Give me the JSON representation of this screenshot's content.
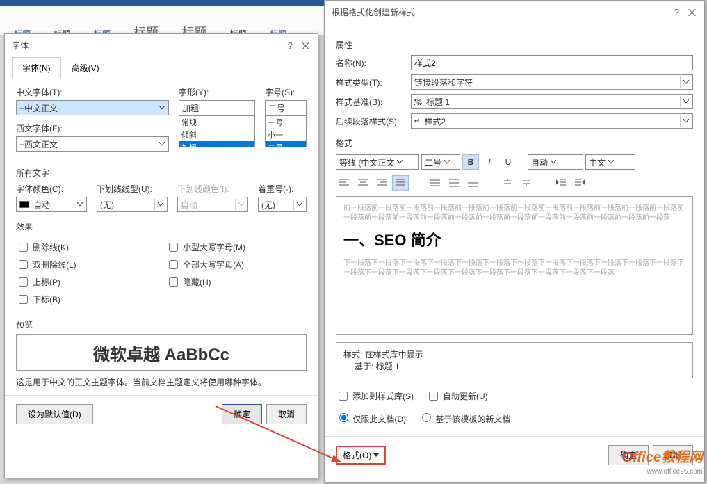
{
  "ribbon": {
    "tabs": [
      "标题",
      "标题",
      "标题",
      "标题",
      "标题",
      "标题",
      "标题"
    ]
  },
  "fontDialog": {
    "title": "字体",
    "tab1": "字体(N)",
    "tab2": "高级(V)",
    "cnFontLbl": "中文字体(T):",
    "cnFontVal": "+中文正文",
    "enFontLbl": "西文字体(F):",
    "enFontVal": "+西文正文",
    "styleLbl": "字形(Y):",
    "styleVal": "加粗",
    "styleOpts": [
      "常规",
      "倾斜",
      "加粗"
    ],
    "sizeLbl": "字号(S):",
    "sizeVal": "二号",
    "sizeOpts": [
      "一号",
      "小一",
      "二号"
    ],
    "allText": "所有文字",
    "colorLbl": "字体颜色(C):",
    "colorVal": "自动",
    "ulStyleLbl": "下划线线型(U):",
    "ulStyleVal": "(无)",
    "ulColorLbl": "下划线颜色(I):",
    "ulColorVal": "自动",
    "emphLbl": "着重号(·):",
    "emphVal": "(无)",
    "effects": "效果",
    "chk1": "删除线(K)",
    "chk2": "双删除线(L)",
    "chk3": "上标(P)",
    "chk4": "下标(B)",
    "chk5": "小型大写字母(M)",
    "chk6": "全部大写字母(A)",
    "chk7": "隐藏(H)",
    "previewLbl": "预览",
    "previewText": "微软卓越  AaBbCc",
    "previewDesc": "这是用于中文的正文主题字体。当前文档主题定义将使用哪种字体。",
    "setDefault": "设为默认值(D)",
    "ok": "确定",
    "cancel": "取消"
  },
  "styleDialog": {
    "title": "根据格式化创建新样式",
    "props": "属性",
    "nameLbl": "名称(N):",
    "nameVal": "样式2",
    "typeLbl": "样式类型(T):",
    "typeVal": "链接段落和字符",
    "baseLbl": "样式基准(B):",
    "baseVal": "标题 1",
    "baseIcon": "¶a",
    "followLbl": "后续段落样式(S):",
    "followVal": "样式2",
    "followIcon": "↵",
    "formatSec": "格式",
    "fontSel": "等线 (中文正文",
    "sizeSel": "二号",
    "autoSel": "自动",
    "langSel": "中文",
    "previewGrey": "前一段落前一段落前一段落前一段落前一段落前一段落前一段落前一段落前一段落前一段落前一段落前一段落前一段落前一段落前一段落前一段落前一段落前一段落前一段落前一段落前一段落前一段落前一段落前一段落",
    "previewHeading": "一、SEO 简介",
    "previewGrey2": "下一段落下一段落下一段落下一段落下一段落下一段落下一段落下一段落下一段落下一段落下一段落下一段落下一段落下一段落下一段落下一段落下一段落下一段落下一段落下一段落下一段落下一段落",
    "infoL1": "样式: 在样式库中显示",
    "infoL2": "基于: 标题 1",
    "addLib": "添加到样式库(S)",
    "autoUpd": "自动更新(U)",
    "radio1": "仅限此文档(D)",
    "radio2": "基于该模板的新文档",
    "formatBtn": "格式(O)",
    "ok": "确定",
    "cancel": "取消"
  },
  "watermark": {
    "brand": "Office教程网",
    "url": "www.office26.com"
  }
}
